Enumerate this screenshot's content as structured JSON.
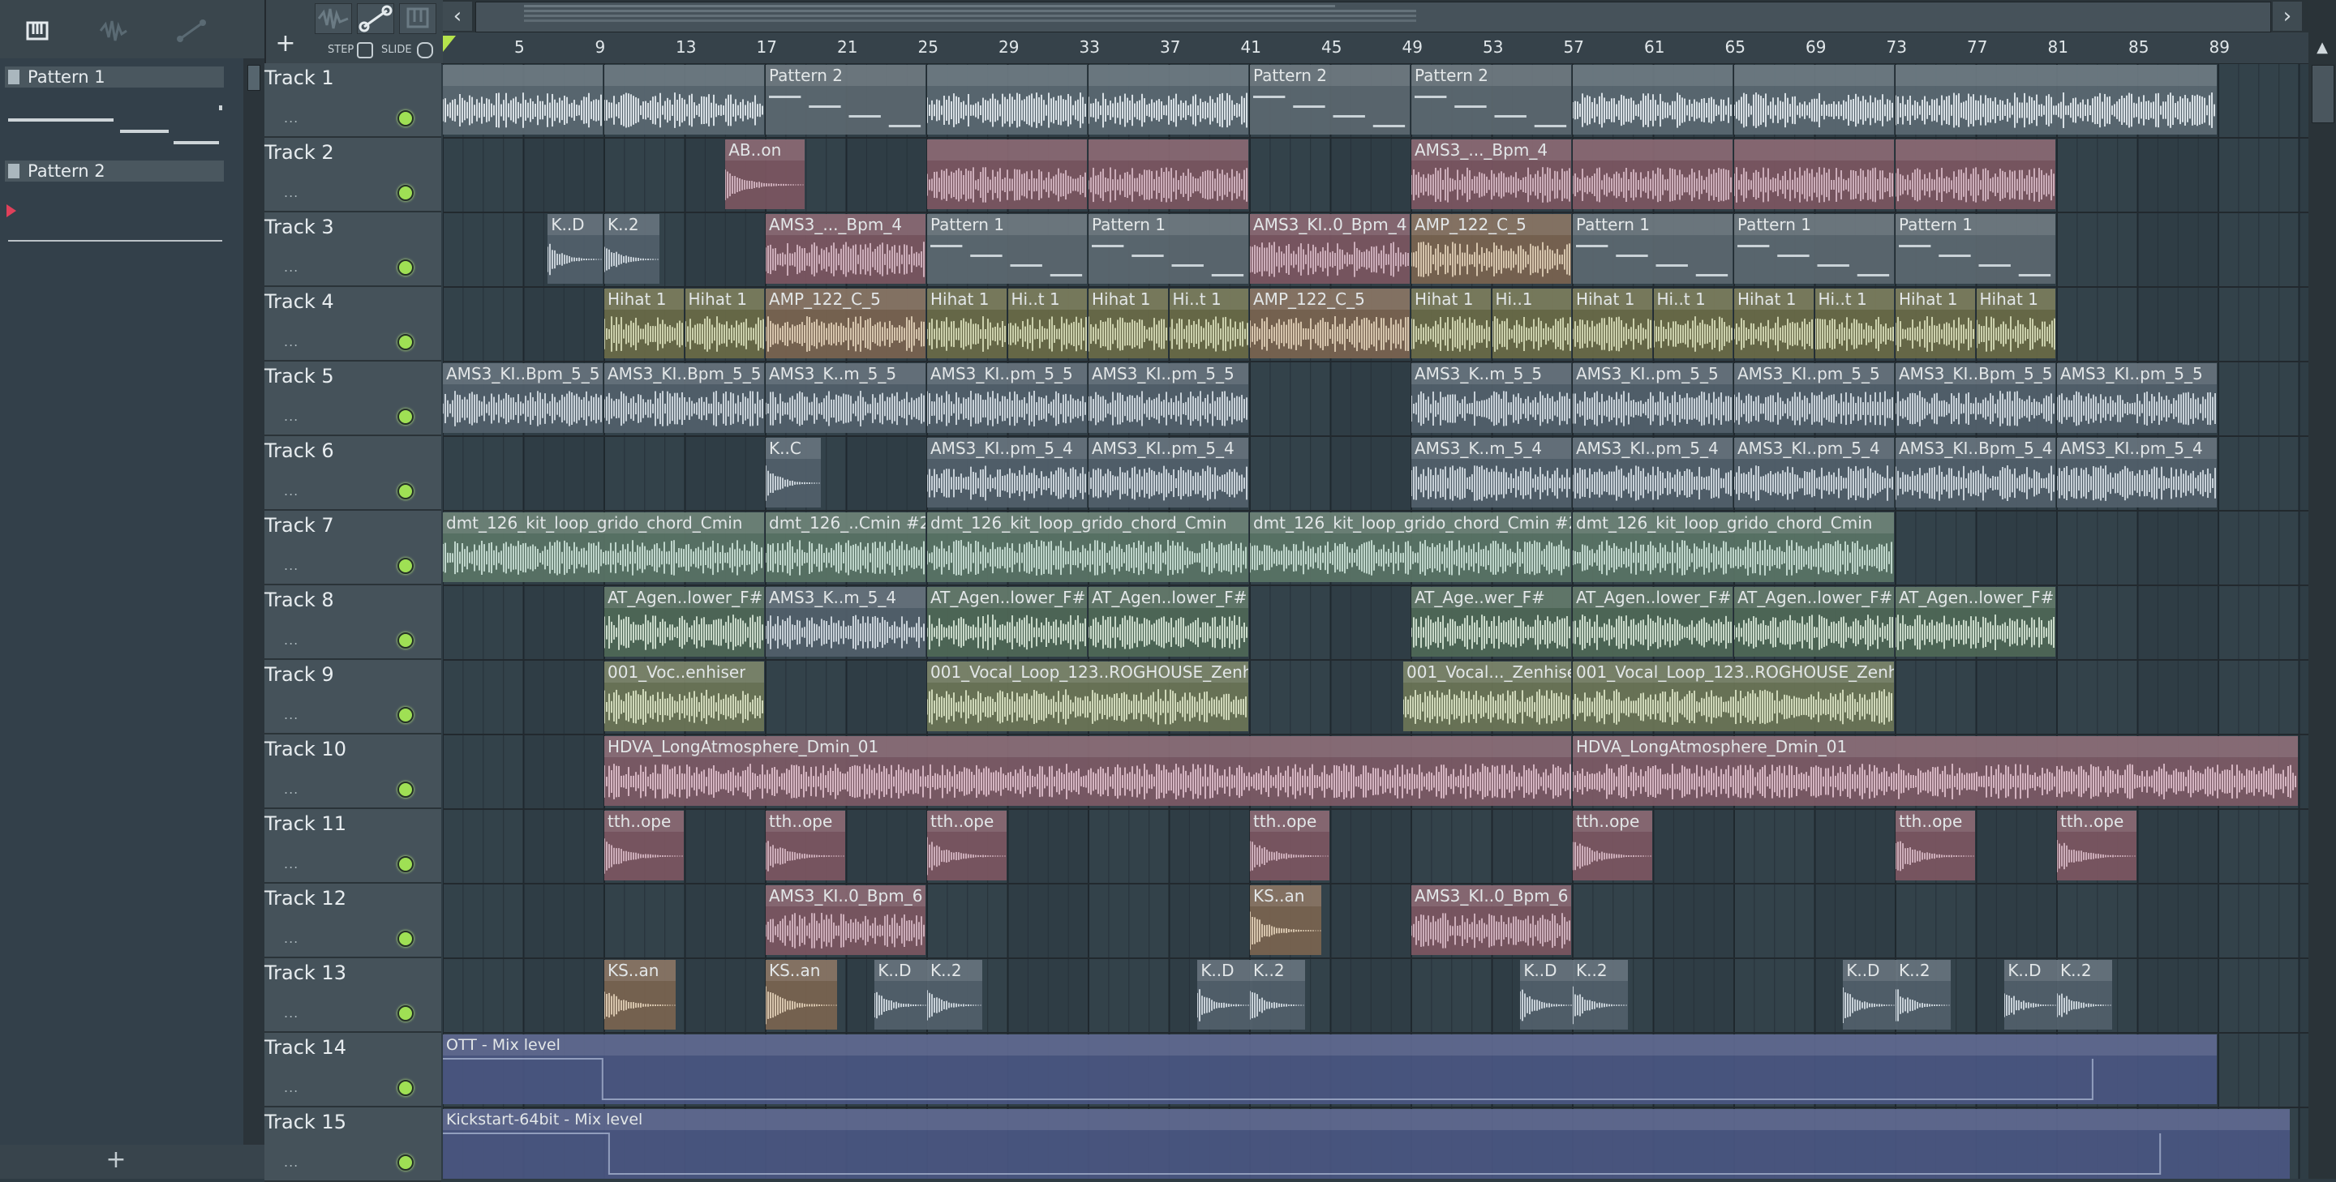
{
  "picker": {
    "patterns": [
      {
        "label": "Pattern 1"
      },
      {
        "label": "Pattern 2"
      }
    ],
    "add_label": "+"
  },
  "toolbar": {
    "add_track_label": "+",
    "step_label": "STEP",
    "slide_label": "SLIDE"
  },
  "overview": {
    "left_arrow": "‹",
    "right_arrow": "›"
  },
  "ruler": {
    "bars": [
      "5",
      "9",
      "13",
      "17",
      "21",
      "25",
      "29",
      "33",
      "37",
      "41",
      "45",
      "49",
      "53",
      "57",
      "61",
      "65",
      "69",
      "73",
      "77",
      "81",
      "85",
      "89"
    ]
  },
  "scroll": {
    "up_arrow": "▲"
  },
  "tracks": [
    {
      "name": "Track 1",
      "dots": "...",
      "clips": [
        {
          "start": 1,
          "len": 2,
          "label": "",
          "kind": "white"
        },
        {
          "start": 3,
          "len": 2,
          "label": "",
          "kind": "white"
        },
        {
          "start": 5,
          "len": 2,
          "label": "Pattern 2",
          "kind": "pattern"
        },
        {
          "start": 7,
          "len": 2,
          "label": "",
          "kind": "white"
        },
        {
          "start": 9,
          "len": 2,
          "label": "",
          "kind": "white"
        },
        {
          "start": 11,
          "len": 2,
          "label": "Pattern 2",
          "kind": "pattern"
        },
        {
          "start": 13,
          "len": 2,
          "label": "Pattern 2",
          "kind": "pattern"
        },
        {
          "start": 15,
          "len": 2,
          "label": "",
          "kind": "white"
        },
        {
          "start": 17,
          "len": 2,
          "label": "",
          "kind": "white"
        },
        {
          "start": 19,
          "len": 4,
          "label": "",
          "kind": "white"
        }
      ]
    },
    {
      "name": "Track 2",
      "dots": "...",
      "clips": [
        {
          "start": 4.5,
          "len": 1,
          "label": "AB..on",
          "kind": "pink"
        },
        {
          "start": 7,
          "len": 2,
          "label": "",
          "kind": "pink"
        },
        {
          "start": 9,
          "len": 2,
          "label": "",
          "kind": "pink"
        },
        {
          "start": 13,
          "len": 2,
          "label": "AMS3_..._Bpm_4",
          "kind": "pink"
        },
        {
          "start": 15,
          "len": 2,
          "label": "",
          "kind": "pink"
        },
        {
          "start": 17,
          "len": 2,
          "label": "",
          "kind": "pink"
        },
        {
          "start": 19,
          "len": 2,
          "label": "",
          "kind": "pink"
        }
      ]
    },
    {
      "name": "Track 3",
      "dots": "...",
      "clips": [
        {
          "start": 2.3,
          "len": 0.7,
          "label": "K..D",
          "kind": "blue"
        },
        {
          "start": 3,
          "len": 0.7,
          "label": "K..2",
          "kind": "blue"
        },
        {
          "start": 5,
          "len": 2,
          "label": "AMS3_..._Bpm_4",
          "kind": "pink"
        },
        {
          "start": 7,
          "len": 2,
          "label": "Pattern 1",
          "kind": "pattern"
        },
        {
          "start": 9,
          "len": 2,
          "label": "Pattern 1",
          "kind": "pattern"
        },
        {
          "start": 11,
          "len": 2,
          "label": "AMS3_KI..0_Bpm_4",
          "kind": "pink"
        },
        {
          "start": 13,
          "len": 2,
          "label": "AMP_122_C_5",
          "kind": "tan"
        },
        {
          "start": 15,
          "len": 2,
          "label": "Pattern 1",
          "kind": "pattern"
        },
        {
          "start": 17,
          "len": 2,
          "label": "Pattern 1",
          "kind": "pattern"
        },
        {
          "start": 19,
          "len": 2,
          "label": "Pattern 1",
          "kind": "pattern"
        }
      ]
    },
    {
      "name": "Track 4",
      "dots": "...",
      "clips": [
        {
          "start": 3,
          "len": 1,
          "label": "Hihat 1",
          "kind": "olive"
        },
        {
          "start": 4,
          "len": 1,
          "label": "Hihat 1",
          "kind": "olive"
        },
        {
          "start": 5,
          "len": 2,
          "label": "AMP_122_C_5",
          "kind": "tan"
        },
        {
          "start": 7,
          "len": 1,
          "label": "Hihat 1",
          "kind": "olive"
        },
        {
          "start": 8,
          "len": 1,
          "label": "Hi..t 1",
          "kind": "olive"
        },
        {
          "start": 9,
          "len": 1,
          "label": "Hihat 1",
          "kind": "olive"
        },
        {
          "start": 10,
          "len": 1,
          "label": "Hi..t 1",
          "kind": "olive"
        },
        {
          "start": 11,
          "len": 2,
          "label": "AMP_122_C_5",
          "kind": "tan"
        },
        {
          "start": 13,
          "len": 1,
          "label": "Hihat 1",
          "kind": "olive"
        },
        {
          "start": 14,
          "len": 1,
          "label": "Hi..1",
          "kind": "olive"
        },
        {
          "start": 15,
          "len": 1,
          "label": "Hihat 1",
          "kind": "olive"
        },
        {
          "start": 16,
          "len": 1,
          "label": "Hi..t 1",
          "kind": "olive"
        },
        {
          "start": 17,
          "len": 1,
          "label": "Hihat 1",
          "kind": "olive"
        },
        {
          "start": 18,
          "len": 1,
          "label": "Hi..t 1",
          "kind": "olive"
        },
        {
          "start": 19,
          "len": 1,
          "label": "Hihat 1",
          "kind": "olive"
        },
        {
          "start": 20,
          "len": 1,
          "label": "Hihat 1",
          "kind": "olive"
        }
      ]
    },
    {
      "name": "Track 5",
      "dots": "...",
      "clips": [
        {
          "start": 1,
          "len": 2,
          "label": "AMS3_KI..Bpm_5_5",
          "kind": "blue"
        },
        {
          "start": 3,
          "len": 2,
          "label": "AMS3_KI..Bpm_5_5",
          "kind": "blue"
        },
        {
          "start": 5,
          "len": 2,
          "label": "AMS3_K..m_5_5",
          "kind": "blue"
        },
        {
          "start": 7,
          "len": 2,
          "label": "AMS3_KI..pm_5_5",
          "kind": "blue"
        },
        {
          "start": 9,
          "len": 2,
          "label": "AMS3_KI..pm_5_5",
          "kind": "blue"
        },
        {
          "start": 13,
          "len": 2,
          "label": "AMS3_K..m_5_5",
          "kind": "blue"
        },
        {
          "start": 15,
          "len": 2,
          "label": "AMS3_KI..pm_5_5",
          "kind": "blue"
        },
        {
          "start": 17,
          "len": 2,
          "label": "AMS3_KI..pm_5_5",
          "kind": "blue"
        },
        {
          "start": 19,
          "len": 2,
          "label": "AMS3_KI..Bpm_5_5",
          "kind": "blue"
        },
        {
          "start": 21,
          "len": 2,
          "label": "AMS3_KI..pm_5_5",
          "kind": "blue"
        }
      ]
    },
    {
      "name": "Track 6",
      "dots": "...",
      "clips": [
        {
          "start": 5,
          "len": 0.7,
          "label": "K..C",
          "kind": "blue"
        },
        {
          "start": 7,
          "len": 2,
          "label": "AMS3_KI..pm_5_4",
          "kind": "blue"
        },
        {
          "start": 9,
          "len": 2,
          "label": "AMS3_KI..pm_5_4",
          "kind": "blue"
        },
        {
          "start": 13,
          "len": 2,
          "label": "AMS3_K..m_5_4",
          "kind": "blue"
        },
        {
          "start": 15,
          "len": 2,
          "label": "AMS3_KI..pm_5_4",
          "kind": "blue"
        },
        {
          "start": 17,
          "len": 2,
          "label": "AMS3_KI..pm_5_4",
          "kind": "blue"
        },
        {
          "start": 19,
          "len": 2,
          "label": "AMS3_KI..Bpm_5_4",
          "kind": "blue"
        },
        {
          "start": 21,
          "len": 2,
          "label": "AMS3_KI..pm_5_4",
          "kind": "blue"
        }
      ]
    },
    {
      "name": "Track 7",
      "dots": "...",
      "clips": [
        {
          "start": 1,
          "len": 4,
          "label": "dmt_126_kit_loop_grido_chord_Cmin",
          "kind": "mint"
        },
        {
          "start": 5,
          "len": 2,
          "label": "dmt_126_..Cmin #2",
          "kind": "mint"
        },
        {
          "start": 7,
          "len": 4,
          "label": "dmt_126_kit_loop_grido_chord_Cmin",
          "kind": "mint"
        },
        {
          "start": 11,
          "len": 4,
          "label": "dmt_126_kit_loop_grido_chord_Cmin #2",
          "kind": "mint"
        },
        {
          "start": 15,
          "len": 4,
          "label": "dmt_126_kit_loop_grido_chord_Cmin",
          "kind": "mint"
        }
      ]
    },
    {
      "name": "Track 8",
      "dots": "...",
      "clips": [
        {
          "start": 3,
          "len": 2,
          "label": "AT_Agen..lower_F#",
          "kind": "green"
        },
        {
          "start": 5,
          "len": 2,
          "label": "AMS3_K..m_5_4",
          "kind": "blue"
        },
        {
          "start": 7,
          "len": 2,
          "label": "AT_Agen..lower_F#",
          "kind": "green"
        },
        {
          "start": 9,
          "len": 2,
          "label": "AT_Agen..lower_F#",
          "kind": "green"
        },
        {
          "start": 13,
          "len": 2,
          "label": "AT_Age..wer_F#",
          "kind": "green"
        },
        {
          "start": 15,
          "len": 2,
          "label": "AT_Agen..lower_F#",
          "kind": "green"
        },
        {
          "start": 17,
          "len": 2,
          "label": "AT_Agen..lower_F#",
          "kind": "green"
        },
        {
          "start": 19,
          "len": 2,
          "label": "AT_Agen..lower_F#",
          "kind": "green"
        }
      ]
    },
    {
      "name": "Track 9",
      "dots": "...",
      "clips": [
        {
          "start": 3,
          "len": 2,
          "label": "001_Voc..enhiser",
          "kind": "sage"
        },
        {
          "start": 7,
          "len": 4,
          "label": "001_Vocal_Loop_123..ROGHOUSE_Zenhiser",
          "kind": "sage"
        },
        {
          "start": 12.9,
          "len": 2.1,
          "label": "001_Vocal..._Zenhiser",
          "kind": "sage"
        },
        {
          "start": 15,
          "len": 4,
          "label": "001_Vocal_Loop_123..ROGHOUSE_Zenhiser",
          "kind": "sage"
        }
      ]
    },
    {
      "name": "Track 10",
      "dots": "...",
      "clips": [
        {
          "start": 3,
          "len": 12,
          "label": "HDVA_LongAtmosphere_Dmin_01",
          "kind": "mauve"
        },
        {
          "start": 15,
          "len": 9,
          "label": "HDVA_LongAtmosphere_Dmin_01",
          "kind": "mauve"
        }
      ]
    },
    {
      "name": "Track 11",
      "dots": "...",
      "clips": [
        {
          "start": 3,
          "len": 1,
          "label": "tth..ope",
          "kind": "pink"
        },
        {
          "start": 5,
          "len": 1,
          "label": "tth..ope",
          "kind": "pink"
        },
        {
          "start": 7,
          "len": 1,
          "label": "tth..ope",
          "kind": "pink"
        },
        {
          "start": 11,
          "len": 1,
          "label": "tth..ope",
          "kind": "pink"
        },
        {
          "start": 15,
          "len": 1,
          "label": "tth..ope",
          "kind": "pink"
        },
        {
          "start": 19,
          "len": 1,
          "label": "tth..ope",
          "kind": "pink"
        },
        {
          "start": 21,
          "len": 1,
          "label": "tth..ope",
          "kind": "pink"
        }
      ]
    },
    {
      "name": "Track 12",
      "dots": "...",
      "clips": [
        {
          "start": 5,
          "len": 2,
          "label": "AMS3_KI..0_Bpm_6",
          "kind": "pink"
        },
        {
          "start": 11,
          "len": 0.9,
          "label": "KS..an",
          "kind": "tan"
        },
        {
          "start": 13,
          "len": 2,
          "label": "AMS3_KI..0_Bpm_6",
          "kind": "pink"
        }
      ]
    },
    {
      "name": "Track 13",
      "dots": "...",
      "clips": [
        {
          "start": 3,
          "len": 0.9,
          "label": "KS..an",
          "kind": "tan"
        },
        {
          "start": 5,
          "len": 0.9,
          "label": "KS..an",
          "kind": "tan"
        },
        {
          "start": 6.35,
          "len": 0.7,
          "label": "K..D",
          "kind": "blue"
        },
        {
          "start": 7,
          "len": 0.7,
          "label": "K..2",
          "kind": "blue"
        },
        {
          "start": 10.35,
          "len": 0.7,
          "label": "K..D",
          "kind": "blue"
        },
        {
          "start": 11,
          "len": 0.7,
          "label": "K..2",
          "kind": "blue"
        },
        {
          "start": 14.35,
          "len": 0.7,
          "label": "K..D",
          "kind": "blue"
        },
        {
          "start": 15,
          "len": 0.7,
          "label": "K..2",
          "kind": "blue"
        },
        {
          "start": 18.35,
          "len": 0.7,
          "label": "K..D",
          "kind": "blue"
        },
        {
          "start": 19,
          "len": 0.7,
          "label": "K..2",
          "kind": "blue"
        },
        {
          "start": 20.35,
          "len": 0.7,
          "label": "K..D",
          "kind": "blue"
        },
        {
          "start": 21,
          "len": 0.7,
          "label": "K..2",
          "kind": "blue"
        }
      ]
    },
    {
      "name": "Track 14",
      "dots": "...",
      "clips": [
        {
          "start": 1,
          "len": 22,
          "label": "OTT - Mix level",
          "kind": "automation"
        }
      ]
    },
    {
      "name": "Track 15",
      "dots": "...",
      "clips": [
        {
          "start": 1,
          "len": 22.9,
          "label": "Kickstart-64bit - Mix level",
          "kind": "automation"
        }
      ]
    }
  ],
  "colors": {
    "white": "#5b6972",
    "pink": "#7c5661",
    "pattern": "#5c6870",
    "blue": "#52606b",
    "olive": "#6a6b47",
    "tan": "#7a6450",
    "mint": "#5a7466",
    "green": "#4f6857",
    "sage": "#6c7657",
    "mauve": "#7d5a66",
    "automation": "#4a5682",
    "wave_white": "#e6edf2",
    "wave_pink": "#d9b7c3",
    "wave_blue": "#d4dde4",
    "wave_olive": "#d9ddb5",
    "wave_tan": "#e4d0b5",
    "wave_mint": "#cbe2d6",
    "wave_green": "#d6e6d4",
    "wave_sage": "#dde5c3",
    "wave_mauve": "#e3bfcc",
    "accent_led": "#9fe054",
    "play_marker": "#b5e34c"
  }
}
